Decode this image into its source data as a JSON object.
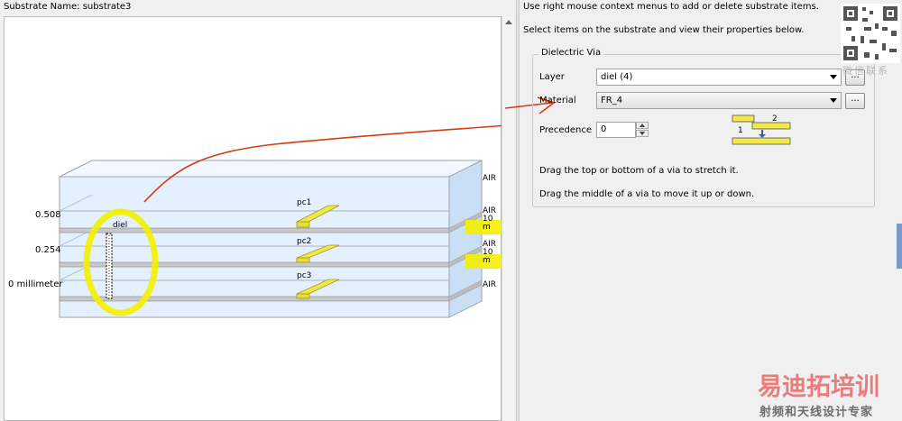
{
  "header": {
    "substrate_label": "Substrate Name:",
    "substrate_name": "substrate3"
  },
  "instructions": {
    "line1": "Use right mouse context menus to add or delete substrate items.",
    "line2": "Select items on the substrate and view their properties below."
  },
  "properties": {
    "group_title": "Dielectric Via",
    "layer_label": "Layer",
    "layer_value": "diel (4)",
    "layer_button": "...",
    "material_label": "Material",
    "material_value": "FR_4",
    "material_button": "...",
    "precedence_label": "Precedence",
    "precedence_value": "0",
    "help1": "Drag the top or bottom of a via to stretch it.",
    "help2": "Drag the middle of a via to move it up or down.",
    "diagram_num1": "1",
    "diagram_num2": "2"
  },
  "substrate": {
    "z_labels": [
      "0.508",
      "0.254",
      "0 millimeter"
    ],
    "conductors": [
      "pc1",
      "pc2",
      "pc3"
    ],
    "via_label": "diel",
    "side_labels": [
      "AIR",
      "AIR",
      "AIR",
      "AIR"
    ],
    "side_thickness": [
      "10 m",
      "10 m"
    ]
  },
  "watermark": {
    "wechat": "微信联系",
    "brand": "易迪拓培训",
    "tagline": "射频和天线设计专家"
  },
  "colors": {
    "highlight": "#f4f000",
    "arrow": "#d23c14",
    "layer_fill": "#d9eaf9",
    "conductor": "#e8dd3a"
  }
}
